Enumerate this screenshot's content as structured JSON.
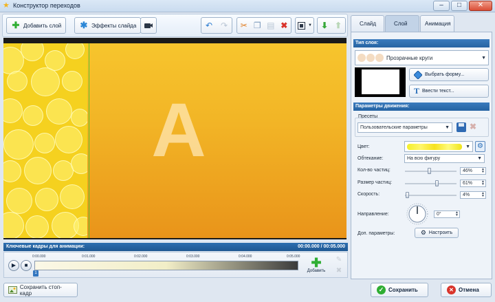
{
  "window": {
    "title": "Конструктор переходов",
    "btn_min": "–",
    "btn_max": "□",
    "btn_close": "✕"
  },
  "toolbar": {
    "add_layer": "Добавить слой",
    "slide_effects": "Эффекты слайда"
  },
  "preview": {
    "letter": "A"
  },
  "keyframes": {
    "header": "Ключевые кадры для анимации:",
    "time": "00:00.000 / 00:05.000",
    "ticks": [
      "0:00.000",
      "0:01.000",
      "0:02.000",
      "0:03.000",
      "0:04.000",
      "0:05.000"
    ],
    "marker": "1",
    "add_label": "Добавить"
  },
  "bottom": {
    "save_frame": "Сохранить стоп-кадр",
    "save": "Сохранить",
    "cancel": "Отмена"
  },
  "tabs": [
    "Слайд",
    "Слой",
    "Анимация"
  ],
  "layer_type": {
    "header": "Тип слоя:",
    "selected": "Прозрачные круги",
    "choose_shape": "Выбрать форму...",
    "enter_text": "Ввести текст..."
  },
  "motion": {
    "header": "Параметры движения:",
    "presets_label": "Пресеты",
    "preset_value": "Пользовательские параметры",
    "color_label": "Цвет:",
    "flow_label": "Обтекание:",
    "flow_value": "На всю фигуру",
    "count_label": "Кол-во частиц:",
    "count_value": "46%",
    "count_level": 0.46,
    "size_label": "Размер частиц:",
    "size_value": "61%",
    "size_level": 0.61,
    "speed_label": "Скорость:",
    "speed_value": "4%",
    "speed_level": 0.04,
    "direction_label": "Направление:",
    "direction_value": "0°",
    "extra_label": "Доп. параметры:",
    "configure": "Настроить"
  }
}
